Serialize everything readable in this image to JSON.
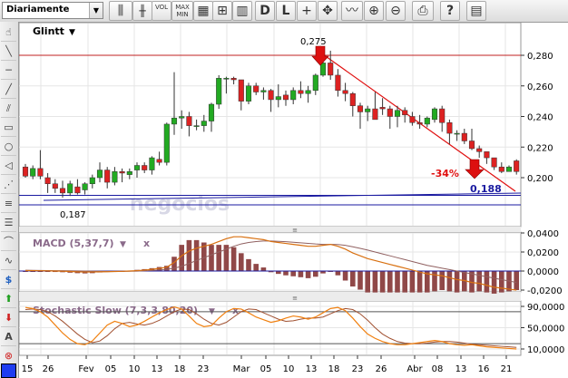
{
  "toolbar": {
    "period_selector": "Diariamente",
    "vol_label": "VOL",
    "maxmin_label_1": "MAX",
    "maxmin_label_2": "MIN",
    "d_label": "D",
    "l_label": "L"
  },
  "price_panel": {
    "ticker": "Glintt",
    "high_label": "0,275",
    "low_label": "0,187",
    "change_label": "-34%",
    "current_label": "0,188",
    "watermark": "negocios",
    "y_ticks": [
      "0,280",
      "0,260",
      "0,240",
      "0,220",
      "0,200"
    ]
  },
  "macd_panel": {
    "title": "MACD (5,37,7)",
    "close_label": "x",
    "y_ticks": [
      "0,0400",
      "0,0200",
      "0,0000",
      "-0,0200"
    ]
  },
  "stoch_panel": {
    "title": "Stochastic Slow (7,3,3,80,20)",
    "close_label": "x",
    "y_ticks": [
      "90,0000",
      "50,0000",
      "10,0000"
    ]
  },
  "x_axis": {
    "ticks": [
      "15",
      "26",
      "Fev",
      "05",
      "10",
      "13",
      "18",
      "23",
      "Mar",
      "05",
      "10",
      "13",
      "18",
      "23",
      "26",
      "Abr",
      "08",
      "13",
      "16",
      "21"
    ]
  },
  "colors": {
    "up": "#22aa22",
    "down": "#dd2222",
    "trend_red": "#e01010",
    "support_blue": "#1a1aa0",
    "macd_line": "#d87010",
    "signal_line": "#906060",
    "histogram": "#904848",
    "stoch_k": "#f08010",
    "stoch_d": "#a05030"
  },
  "chart_data": {
    "type": "candlestick",
    "candles": [
      [
        0.207,
        0.209,
        0.2,
        0.201
      ],
      [
        0.201,
        0.208,
        0.199,
        0.206
      ],
      [
        0.206,
        0.218,
        0.199,
        0.201
      ],
      [
        0.2,
        0.203,
        0.19,
        0.196
      ],
      [
        0.196,
        0.199,
        0.19,
        0.193
      ],
      [
        0.193,
        0.198,
        0.187,
        0.19
      ],
      [
        0.19,
        0.198,
        0.188,
        0.196
      ],
      [
        0.194,
        0.199,
        0.189,
        0.19
      ],
      [
        0.192,
        0.197,
        0.189,
        0.196
      ],
      [
        0.196,
        0.202,
        0.193,
        0.2
      ],
      [
        0.2,
        0.21,
        0.197,
        0.205
      ],
      [
        0.205,
        0.207,
        0.193,
        0.197
      ],
      [
        0.197,
        0.207,
        0.195,
        0.204
      ],
      [
        0.204,
        0.206,
        0.197,
        0.203
      ],
      [
        0.202,
        0.206,
        0.199,
        0.204
      ],
      [
        0.205,
        0.21,
        0.2,
        0.208
      ],
      [
        0.208,
        0.21,
        0.203,
        0.205
      ],
      [
        0.205,
        0.214,
        0.202,
        0.213
      ],
      [
        0.212,
        0.217,
        0.208,
        0.21
      ],
      [
        0.21,
        0.236,
        0.208,
        0.235
      ],
      [
        0.235,
        0.269,
        0.228,
        0.239
      ],
      [
        0.239,
        0.244,
        0.232,
        0.24
      ],
      [
        0.24,
        0.243,
        0.227,
        0.234
      ],
      [
        0.234,
        0.238,
        0.231,
        0.234
      ],
      [
        0.234,
        0.241,
        0.23,
        0.237
      ],
      [
        0.237,
        0.249,
        0.23,
        0.248
      ],
      [
        0.248,
        0.267,
        0.245,
        0.265
      ],
      [
        0.265,
        0.266,
        0.255,
        0.265
      ],
      [
        0.265,
        0.266,
        0.261,
        0.264
      ],
      [
        0.264,
        0.262,
        0.244,
        0.25
      ],
      [
        0.25,
        0.262,
        0.248,
        0.26
      ],
      [
        0.26,
        0.262,
        0.254,
        0.256
      ],
      [
        0.256,
        0.259,
        0.251,
        0.257
      ],
      [
        0.257,
        0.258,
        0.243,
        0.251
      ],
      [
        0.251,
        0.261,
        0.246,
        0.253
      ],
      [
        0.254,
        0.257,
        0.247,
        0.251
      ],
      [
        0.251,
        0.259,
        0.248,
        0.257
      ],
      [
        0.257,
        0.263,
        0.252,
        0.255
      ],
      [
        0.255,
        0.26,
        0.249,
        0.257
      ],
      [
        0.257,
        0.268,
        0.254,
        0.267
      ],
      [
        0.267,
        0.276,
        0.266,
        0.275
      ],
      [
        0.275,
        0.283,
        0.264,
        0.267
      ],
      [
        0.267,
        0.271,
        0.253,
        0.257
      ],
      [
        0.257,
        0.262,
        0.25,
        0.255
      ],
      [
        0.255,
        0.256,
        0.24,
        0.247
      ],
      [
        0.247,
        0.249,
        0.232,
        0.243
      ],
      [
        0.243,
        0.247,
        0.237,
        0.245
      ],
      [
        0.245,
        0.256,
        0.242,
        0.238
      ],
      [
        0.246,
        0.252,
        0.241,
        0.245
      ],
      [
        0.245,
        0.247,
        0.232,
        0.24
      ],
      [
        0.24,
        0.247,
        0.233,
        0.244
      ],
      [
        0.244,
        0.246,
        0.236,
        0.241
      ],
      [
        0.24,
        0.243,
        0.234,
        0.236
      ],
      [
        0.236,
        0.241,
        0.232,
        0.235
      ],
      [
        0.235,
        0.24,
        0.233,
        0.239
      ],
      [
        0.238,
        0.246,
        0.236,
        0.245
      ],
      [
        0.245,
        0.247,
        0.23,
        0.236
      ],
      [
        0.236,
        0.238,
        0.222,
        0.229
      ],
      [
        0.229,
        0.231,
        0.224,
        0.229
      ],
      [
        0.229,
        0.232,
        0.222,
        0.224
      ],
      [
        0.224,
        0.232,
        0.218,
        0.219
      ],
      [
        0.219,
        0.221,
        0.213,
        0.217
      ],
      [
        0.217,
        0.216,
        0.209,
        0.213
      ],
      [
        0.213,
        0.212,
        0.205,
        0.207
      ],
      [
        0.207,
        0.21,
        0.203,
        0.204
      ],
      [
        0.204,
        0.208,
        0.204,
        0.207
      ],
      [
        0.211,
        0.212,
        0.202,
        0.204
      ]
    ],
    "macd": [
      0.0005,
      0.0004,
      0.0003,
      0.0002,
      0.0,
      -0.0002,
      -0.0005,
      -0.0008,
      -0.001,
      -0.001,
      -0.0008,
      -0.0007,
      -0.0005,
      -0.0003,
      0.0,
      0.0004,
      0.001,
      0.0018,
      0.0028,
      0.004,
      0.009,
      0.016,
      0.021,
      0.024,
      0.026,
      0.028,
      0.031,
      0.034,
      0.036,
      0.036,
      0.035,
      0.034,
      0.033,
      0.031,
      0.03,
      0.029,
      0.028,
      0.027,
      0.026,
      0.026,
      0.027,
      0.028,
      0.026,
      0.023,
      0.019,
      0.016,
      0.013,
      0.011,
      0.009,
      0.007,
      0.005,
      0.003,
      0.001,
      -0.001,
      -0.003,
      -0.004,
      -0.005,
      -0.007,
      -0.009,
      -0.01,
      -0.012,
      -0.013,
      -0.015,
      -0.017,
      -0.018,
      -0.019,
      -0.02
    ],
    "signal": [
      0.0008,
      0.0007,
      0.0006,
      0.0005,
      0.0004,
      0.0003,
      0.0002,
      0.0001,
      0.0,
      -0.0001,
      -0.0002,
      -0.0003,
      -0.0003,
      -0.0003,
      -0.0002,
      -0.0001,
      0.0002,
      0.0006,
      0.0011,
      0.0018,
      0.003,
      0.005,
      0.008,
      0.011,
      0.014,
      0.017,
      0.02,
      0.023,
      0.026,
      0.0285,
      0.03,
      0.031,
      0.0315,
      0.0315,
      0.0312,
      0.0308,
      0.0302,
      0.0296,
      0.029,
      0.0284,
      0.028,
      0.028,
      0.0278,
      0.027,
      0.0255,
      0.0238,
      0.022,
      0.02,
      0.018,
      0.016,
      0.014,
      0.012,
      0.01,
      0.008,
      0.006,
      0.0045,
      0.003,
      0.0015,
      0.0,
      -0.0015,
      -0.003,
      -0.0045,
      -0.006,
      -0.0075,
      -0.009,
      -0.0105,
      -0.012
    ],
    "stoch_k": [
      88,
      86,
      80,
      70,
      55,
      40,
      28,
      20,
      18,
      25,
      40,
      55,
      62,
      58,
      52,
      55,
      62,
      70,
      78,
      84,
      89,
      85,
      72,
      58,
      52,
      54,
      68,
      80,
      86,
      85,
      78,
      70,
      65,
      60,
      63,
      68,
      72,
      70,
      66,
      70,
      78,
      86,
      88,
      82,
      68,
      52,
      38,
      30,
      24,
      20,
      18,
      18,
      20,
      22,
      24,
      26,
      24,
      20,
      18,
      17,
      18,
      16,
      14,
      13,
      12,
      11,
      10
    ],
    "stoch_d": [
      84,
      85,
      84,
      80,
      72,
      62,
      50,
      38,
      28,
      22,
      25,
      35,
      48,
      58,
      60,
      57,
      55,
      58,
      64,
      72,
      80,
      85,
      84,
      76,
      66,
      58,
      55,
      60,
      70,
      80,
      85,
      84,
      78,
      72,
      66,
      62,
      63,
      66,
      68,
      68,
      70,
      76,
      82,
      86,
      84,
      76,
      64,
      50,
      38,
      30,
      24,
      21,
      20,
      20,
      21,
      23,
      24,
      24,
      23,
      21,
      19,
      18,
      17,
      16,
      15,
      14,
      13
    ]
  }
}
